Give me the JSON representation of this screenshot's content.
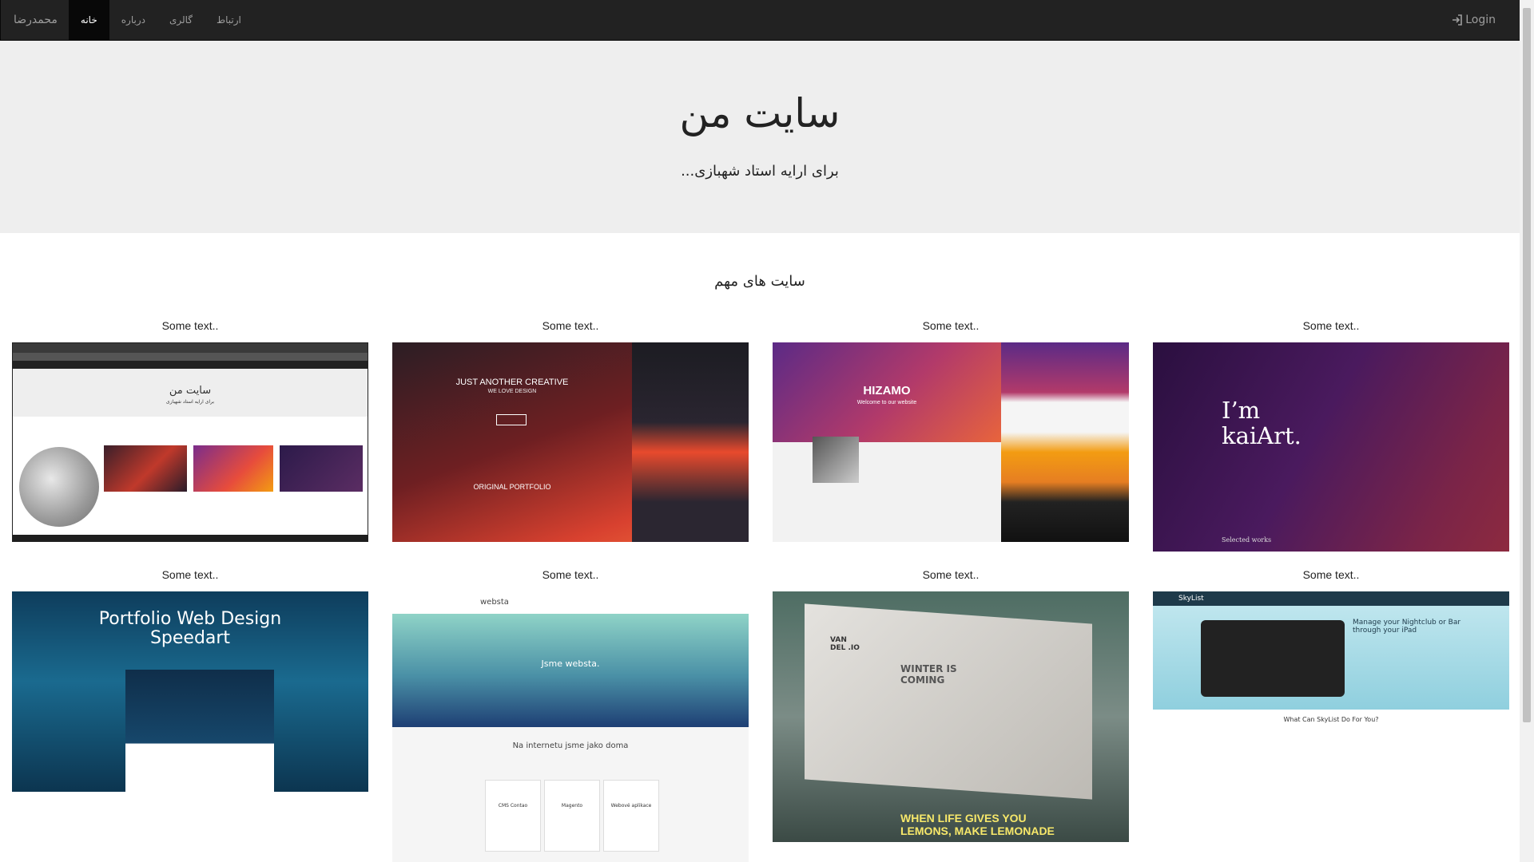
{
  "navbar": {
    "brand": "محمدرضا",
    "items": [
      {
        "label": "خانه",
        "active": true
      },
      {
        "label": "درباره",
        "active": false
      },
      {
        "label": "گالری",
        "active": false
      },
      {
        "label": "ارتباط",
        "active": false
      }
    ],
    "login": "Login"
  },
  "hero": {
    "title": "سایت من",
    "subtitle": "...برای ارایه استاد شهبازی"
  },
  "gallery": {
    "title": "سایت های مهم",
    "cards": [
      {
        "caption": "Some text.."
      },
      {
        "caption": "Some text.."
      },
      {
        "caption": "Some text.."
      },
      {
        "caption": "Some text.."
      },
      {
        "caption": "Some text.."
      },
      {
        "caption": "Some text.."
      },
      {
        "caption": "Some text.."
      },
      {
        "caption": "Some text.."
      }
    ],
    "thumb_text": {
      "t1_title": "سایت من",
      "t1_sub": "برای ارایه استاد شهبازی",
      "t2_head": "JUST ANOTHER CREATIVE",
      "t2_sub": "WE LOVE DESIGN",
      "t2_portfolio": "ORIGINAL PORTFOLIO",
      "t3_brand": "HIZAMO",
      "t3_welcome": "Welcome to our website",
      "t4_line1": "I’m",
      "t4_line2": "kaiArt.",
      "t4_footer": "Selected works",
      "t5_line1": "Portfolio Web Design",
      "t5_line2": "Speedart",
      "t6_brand": "websta",
      "t6_head": "Jsme websta.",
      "t6_section": "Na internetu jsme jako doma",
      "t6_c1": "CMS Contao",
      "t6_c2": "Magento",
      "t6_c3": "Webové aplikace",
      "t7_logo": "VAN DEL .IO",
      "t7_winter": "WINTER IS COMING",
      "t7_lemons": "WHEN LIFE GIVES YOU LEMONS, MAKE LEMONADE",
      "t8_brand": "SkyList",
      "t8_head": "Manage your Nightclub or Bar through your iPad",
      "t8_q": "What Can SkyList Do For You?"
    }
  }
}
